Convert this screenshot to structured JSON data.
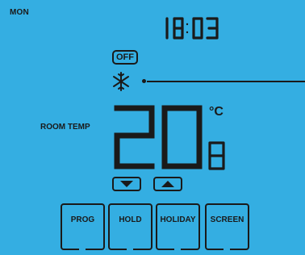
{
  "header": {
    "day": "MON",
    "time": "18:03"
  },
  "status": {
    "mode": "OFF",
    "icon": "snowflake-icon"
  },
  "temperature": {
    "label": "ROOM TEMP",
    "whole": "20",
    "decimal": "8",
    "unit": "°C"
  },
  "controls": {
    "down_icon": "triangle-down-icon",
    "up_icon": "triangle-up-icon"
  },
  "menu": {
    "items": [
      {
        "label": "PROG"
      },
      {
        "label": "HOLD"
      },
      {
        "label": "HOLIDAY"
      },
      {
        "label": "SCREEN"
      }
    ]
  },
  "colors": {
    "background": "#34aee2",
    "foreground": "#1a1a1a"
  }
}
